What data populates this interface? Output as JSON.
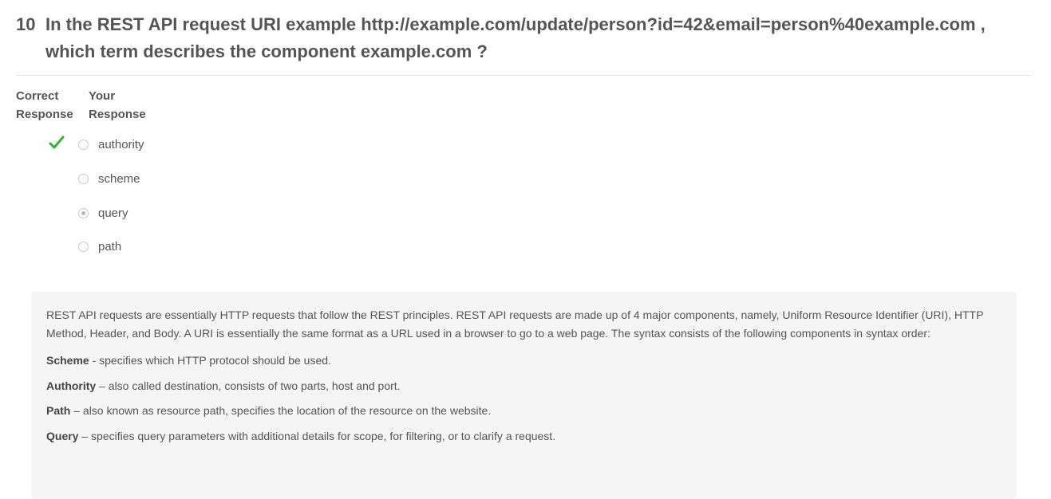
{
  "question": {
    "number": "10",
    "text": "In the REST API request URI example http://example.com/update/person?id=42&email=person%40example.com , which term describes the component example.com ?"
  },
  "columns": {
    "correct_line1": "Correct",
    "correct_line2": "Response",
    "your_line1": "Your",
    "your_line2": "Response"
  },
  "options": [
    {
      "label": "authority",
      "correct": true,
      "selected": false
    },
    {
      "label": "scheme",
      "correct": false,
      "selected": false
    },
    {
      "label": "query",
      "correct": false,
      "selected": true
    },
    {
      "label": "path",
      "correct": false,
      "selected": false
    }
  ],
  "icons": {
    "correct_mark": "checkmark-icon"
  },
  "colors": {
    "check_green": "#2db82d"
  },
  "explanation": {
    "intro": "REST API requests are essentially HTTP requests that follow the REST principles. REST API requests are made up of 4 major components, namely, Uniform Resource Identifier (URI), HTTP Method, Header, and Body. A URI is essentially the same format as a URL used in a browser to go to a web page. The syntax consists of the following components in syntax order:",
    "items": [
      {
        "term": "Scheme",
        "desc": " - specifies which HTTP protocol should be used."
      },
      {
        "term": "Authority",
        "desc": " – also called destination, consists of two parts, host and port."
      },
      {
        "term": "Path",
        "desc": " – also known as resource path, specifies the location of the resource on the website."
      },
      {
        "term": "Query",
        "desc": " – specifies query parameters with additional details for scope, for filtering, or to clarify a request."
      }
    ]
  }
}
